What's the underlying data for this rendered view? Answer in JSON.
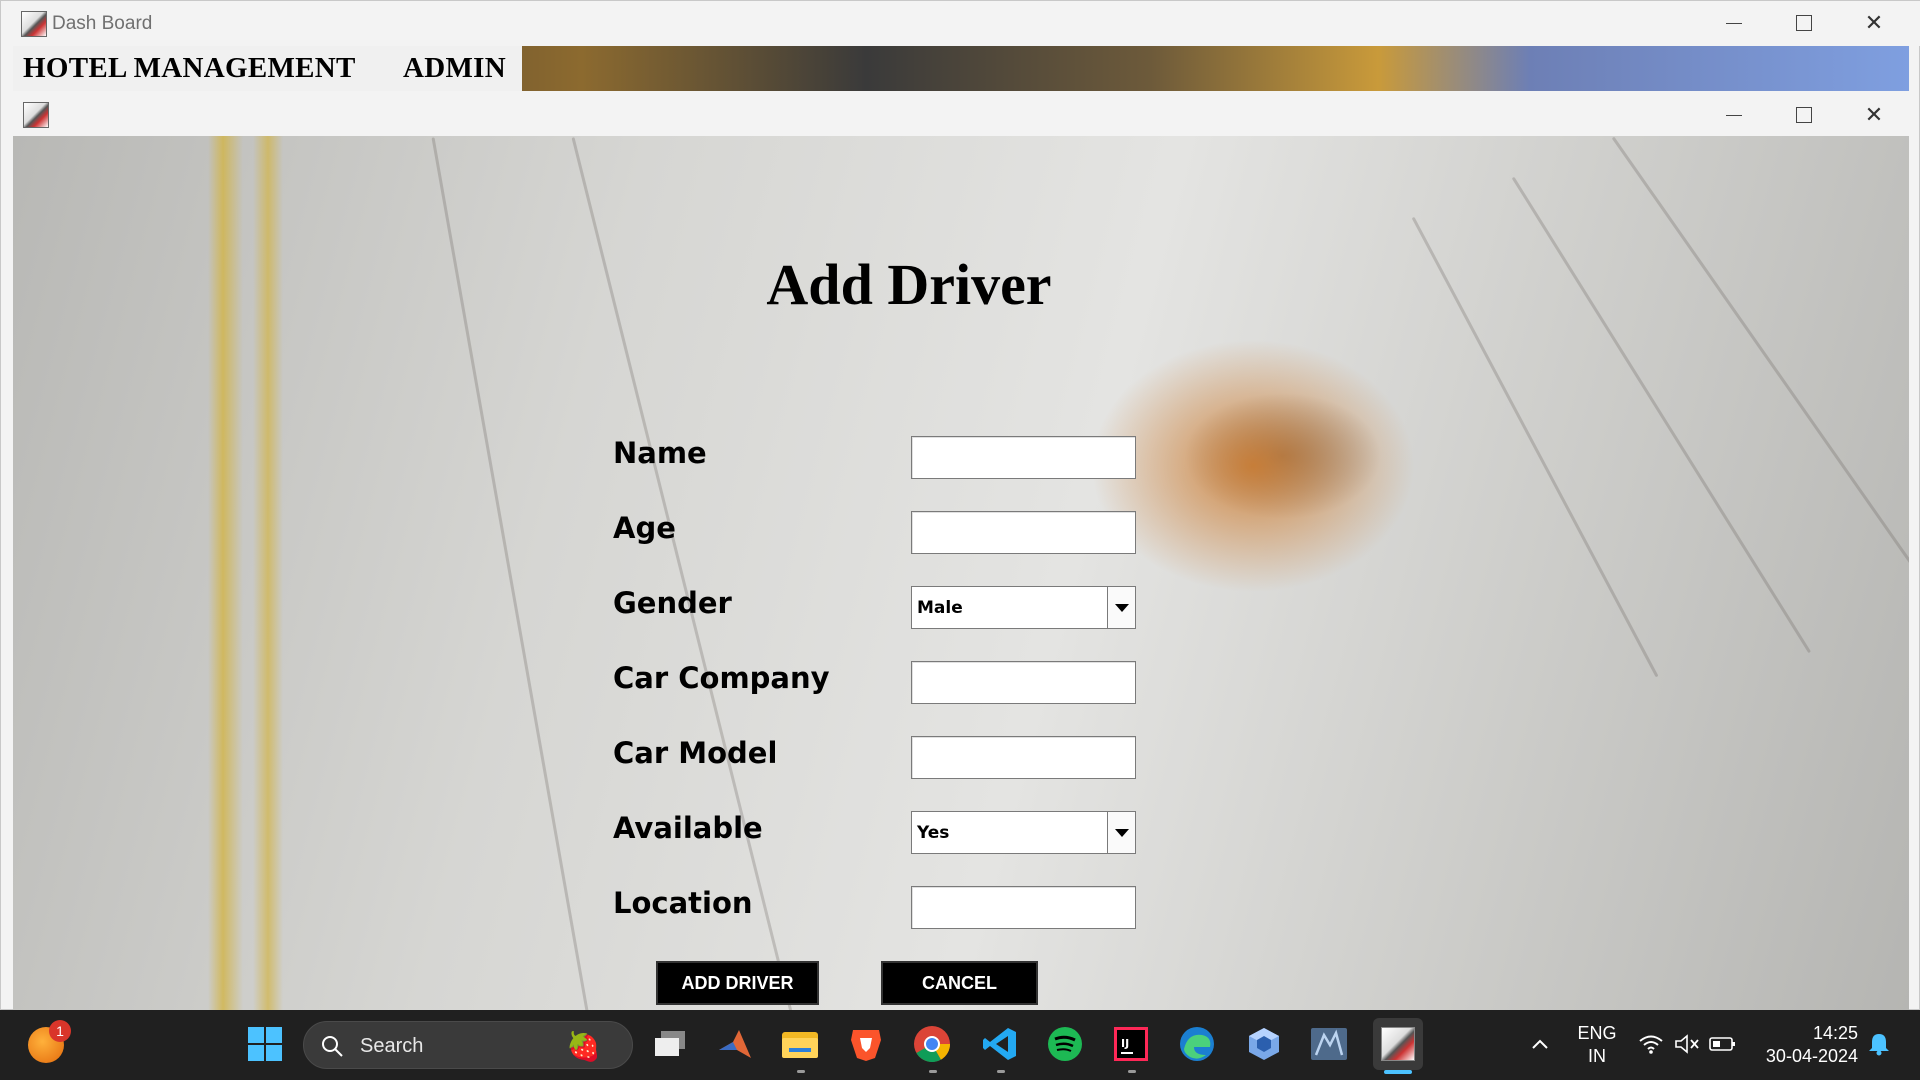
{
  "outer_window": {
    "title": "Dash Board"
  },
  "menubar": {
    "items": [
      "HOTEL MANAGEMENT",
      "ADMIN"
    ]
  },
  "form": {
    "title": "Add Driver",
    "fields": {
      "name": {
        "label": "Name",
        "value": ""
      },
      "age": {
        "label": "Age",
        "value": ""
      },
      "gender": {
        "label": "Gender",
        "selected": "Male"
      },
      "car_company": {
        "label": "Car Company",
        "value": ""
      },
      "car_model": {
        "label": "Car Model",
        "value": ""
      },
      "available": {
        "label": "Available",
        "selected": "Yes"
      },
      "location": {
        "label": "Location",
        "value": ""
      }
    },
    "buttons": {
      "add": "ADD DRIVER",
      "cancel": "CANCEL"
    }
  },
  "taskbar": {
    "notification_count": "1",
    "search_placeholder": "Search",
    "language": "ENG",
    "region": "IN",
    "time": "14:25",
    "date": "30-04-2024",
    "icons": [
      "windows-start-icon",
      "task-view-icon",
      "matlab-icon",
      "file-explorer-icon",
      "brave-icon",
      "chrome-icon",
      "vscode-icon",
      "spotify-icon",
      "intellij-icon",
      "edge-icon",
      "virtualbox-icon",
      "mysql-workbench-icon",
      "java-app-icon"
    ]
  },
  "colors": {
    "taskbar_bg": "#202020",
    "button_bg": "#000000",
    "button_text": "#ffffff"
  }
}
